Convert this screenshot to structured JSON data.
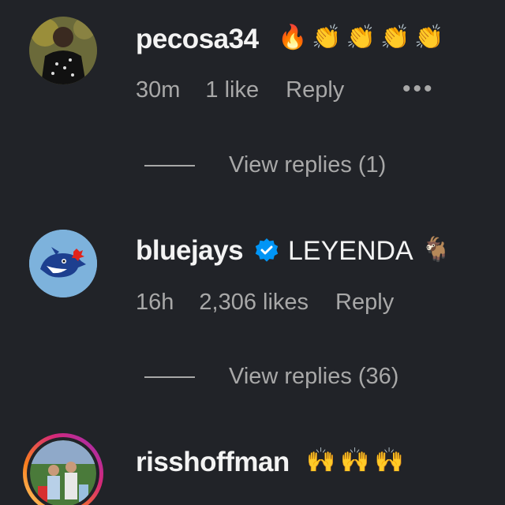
{
  "comments": [
    {
      "username": "pecosa34",
      "text": "",
      "emojis": "🔥👏👏👏👏",
      "time": "30m",
      "likes": "1 like",
      "reply": "Reply",
      "more": "•••",
      "view_replies": "View replies (1)"
    },
    {
      "username": "bluejays",
      "verified": true,
      "text": "LEYENDA",
      "emojis": "🐐",
      "time": "16h",
      "likes": "2,306 likes",
      "reply": "Reply",
      "view_replies": "View replies (36)"
    },
    {
      "username": "risshoffman",
      "text": "",
      "emojis": "🙌🙌🙌"
    }
  ],
  "colors": {
    "background": "#212328",
    "text_primary": "#f3f3f3",
    "text_secondary": "#a8a8a8",
    "verified_blue": "#0095f6",
    "story_ring": "#d62976"
  },
  "icons": {
    "verified": "verified-badge-icon",
    "more": "more-options-icon"
  }
}
